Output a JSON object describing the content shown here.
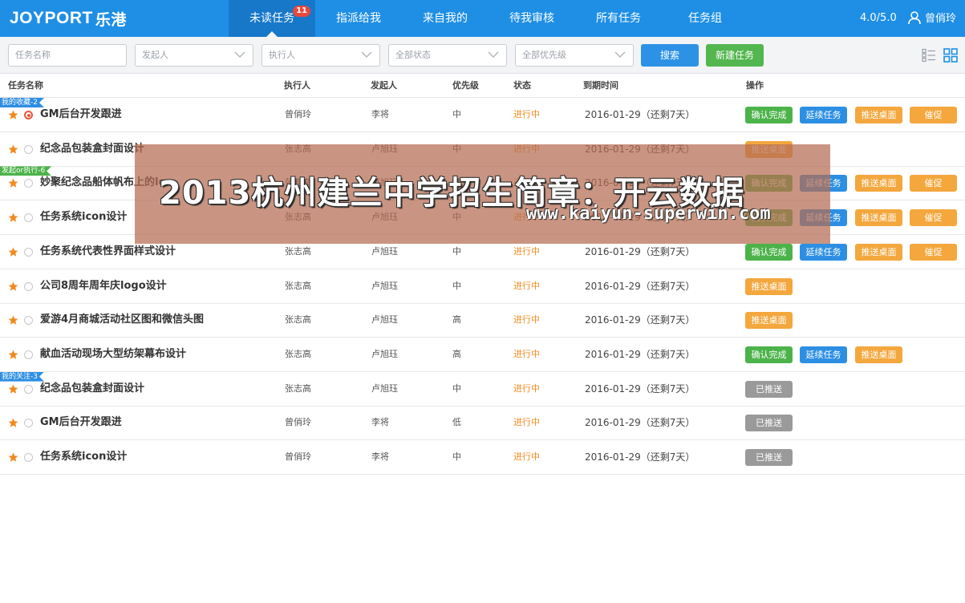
{
  "header": {
    "logo_text": "JOYPORT",
    "logo_cn": "乐港",
    "tabs": [
      {
        "label": "未读任务",
        "badge": "11",
        "active": true
      },
      {
        "label": "指派给我"
      },
      {
        "label": "来自我的"
      },
      {
        "label": "待我审核"
      },
      {
        "label": "所有任务"
      },
      {
        "label": "任务组"
      }
    ],
    "version": "4.0/5.0",
    "user_name": "曾俏玲"
  },
  "filters": {
    "task_name_placeholder": "任务名称",
    "initiator": "发起人",
    "executor": "执行人",
    "status": "全部状态",
    "priority": "全部优先级",
    "search_label": "搜索",
    "new_task_label": "新建任务"
  },
  "table": {
    "columns": [
      "任务名称",
      "执行人",
      "发起人",
      "优先级",
      "状态",
      "到期时间",
      "操作"
    ],
    "groups": [
      {
        "label": "我的收藏-2",
        "color": "blue"
      },
      {
        "label": "发起or执行-6",
        "color": "green"
      },
      {
        "label": "我的关注-3",
        "color": "blue"
      }
    ],
    "rows": [
      {
        "name": "GM后台开发跟进",
        "executor": "曾俏玲",
        "initiator": "李将",
        "priority": "中",
        "status": "进行中",
        "due": "2016-01-29（还剩7天）",
        "actions": [
          "确认完成",
          "延续任务",
          "推送桌面",
          "催促"
        ]
      },
      {
        "name": "纪念品包装盒封面设计",
        "executor": "张志高",
        "initiator": "卢旭珏",
        "priority": "中",
        "status": "进行中",
        "due": "2016-01-29（还剩7天）",
        "actions": [
          "推送桌面"
        ]
      },
      {
        "name": "妙聚纪念品船体帆布上的lo",
        "executor": "张志高",
        "initiator": "卢旭珏",
        "priority": "中",
        "status": "进行中",
        "due": "2016-01-29（还剩7天）",
        "actions": [
          "确认完成",
          "延续任务",
          "推送桌面",
          "催促"
        ]
      },
      {
        "name": "任务系统icon设计",
        "executor": "张志高",
        "initiator": "卢旭珏",
        "priority": "中",
        "status": "进行中",
        "due": "2016-01-29（还剩7天）",
        "actions": [
          "确认完成",
          "延续任务",
          "推送桌面",
          "催促"
        ]
      },
      {
        "name": "任务系统代表性界面样式设计",
        "executor": "张志高",
        "initiator": "卢旭珏",
        "priority": "中",
        "status": "进行中",
        "due": "2016-01-29（还剩7天）",
        "actions": [
          "确认完成",
          "延续任务",
          "推送桌面",
          "催促"
        ]
      },
      {
        "name": "公司8周年周年庆logo设计",
        "executor": "张志高",
        "initiator": "卢旭珏",
        "priority": "中",
        "status": "进行中",
        "due": "2016-01-29（还剩7天）",
        "actions": [
          "推送桌面"
        ]
      },
      {
        "name": "爱游4月商城活动社区图和微信头图",
        "executor": "张志高",
        "initiator": "卢旭珏",
        "priority": "高",
        "status": "进行中",
        "due": "2016-01-29（还剩7天）",
        "actions": [
          "推送桌面"
        ]
      },
      {
        "name": "献血活动现场大型纺架幕布设计",
        "executor": "张志高",
        "initiator": "卢旭珏",
        "priority": "高",
        "status": "进行中",
        "due": "2016-01-29（还剩7天）",
        "actions": [
          "确认完成",
          "延续任务",
          "推送桌面"
        ]
      },
      {
        "name": "纪念品包装盒封面设计",
        "executor": "张志高",
        "initiator": "卢旭珏",
        "priority": "中",
        "status": "进行中",
        "due": "2016-01-29（还剩7天）",
        "actions": [
          "已推送"
        ]
      },
      {
        "name": "GM后台开发跟进",
        "executor": "曾俏玲",
        "initiator": "李将",
        "priority": "低",
        "status": "进行中",
        "due": "2016-01-29（还剩7天）",
        "actions": [
          "已推送"
        ]
      },
      {
        "name": "任务系统icon设计",
        "executor": "曾俏玲",
        "initiator": "李将",
        "priority": "中",
        "status": "进行中",
        "due": "2016-01-29（还剩7天）",
        "actions": [
          "已推送"
        ]
      }
    ]
  },
  "watermark": {
    "title": "2013杭州建兰中学招生简章：开云数据",
    "url": "www.kaiyun-superwin.com"
  },
  "colors": {
    "primary": "#1f8fe6",
    "success": "#4cb34a",
    "warning": "#f3a73d",
    "status_text": "#f08a1e",
    "star": "#f08a1e"
  }
}
